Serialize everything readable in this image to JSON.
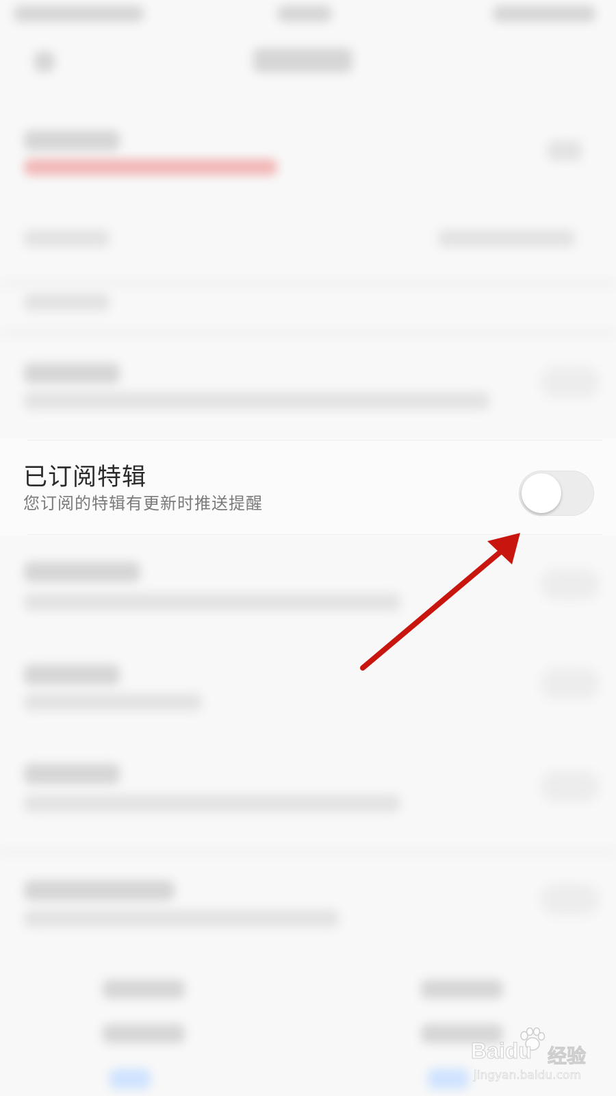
{
  "setting": {
    "title": "已订阅特辑",
    "description": "您订阅的特辑有更新时推送提醒",
    "toggle_on": false
  },
  "annotation": {
    "arrow_color": "#c8160f"
  },
  "watermark": {
    "brand": "Baidu",
    "brand_cn": "经验",
    "url": "jingyan.baidu.com"
  },
  "colors": {
    "toggle_track_off": "#ececec",
    "toggle_knob": "#ffffff"
  }
}
